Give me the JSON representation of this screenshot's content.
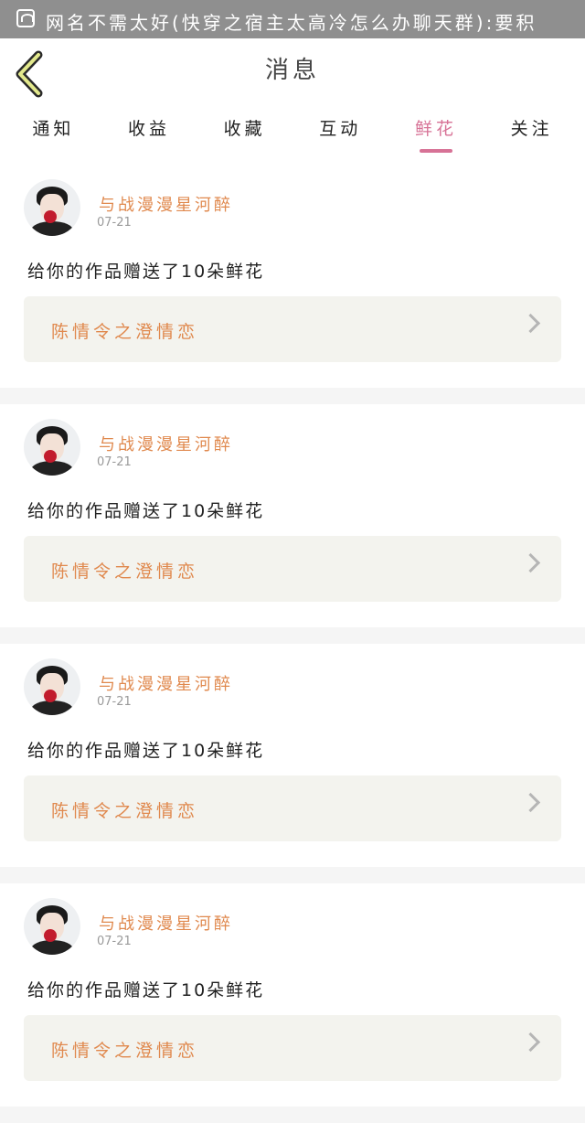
{
  "status_bar": {
    "notification_text": "网名不需太好(快穿之宿主太高冷怎么办聊天群):要积"
  },
  "header": {
    "title": "消息"
  },
  "tabs": [
    {
      "label": "通知",
      "active": false
    },
    {
      "label": "收益",
      "active": false
    },
    {
      "label": "收藏",
      "active": false
    },
    {
      "label": "互动",
      "active": false
    },
    {
      "label": "鲜花",
      "active": true
    },
    {
      "label": "关注",
      "active": false
    }
  ],
  "feed": [
    {
      "user": "与战漫漫星河醉",
      "date": "07-21",
      "message": "给你的作品赠送了10朵鲜花",
      "work_title": "陈情令之澄情恋"
    },
    {
      "user": "与战漫漫星河醉",
      "date": "07-21",
      "message": "给你的作品赠送了10朵鲜花",
      "work_title": "陈情令之澄情恋"
    },
    {
      "user": "与战漫漫星河醉",
      "date": "07-21",
      "message": "给你的作品赠送了10朵鲜花",
      "work_title": "陈情令之澄情恋"
    },
    {
      "user": "与战漫漫星河醉",
      "date": "07-21",
      "message": "给你的作品赠送了10朵鲜花",
      "work_title": "陈情令之澄情恋"
    }
  ],
  "colors": {
    "accent_pink": "#d77296",
    "name_orange": "#e0894e",
    "card_bg": "#f3f3ee",
    "status_bar": "#8f8f8f"
  }
}
